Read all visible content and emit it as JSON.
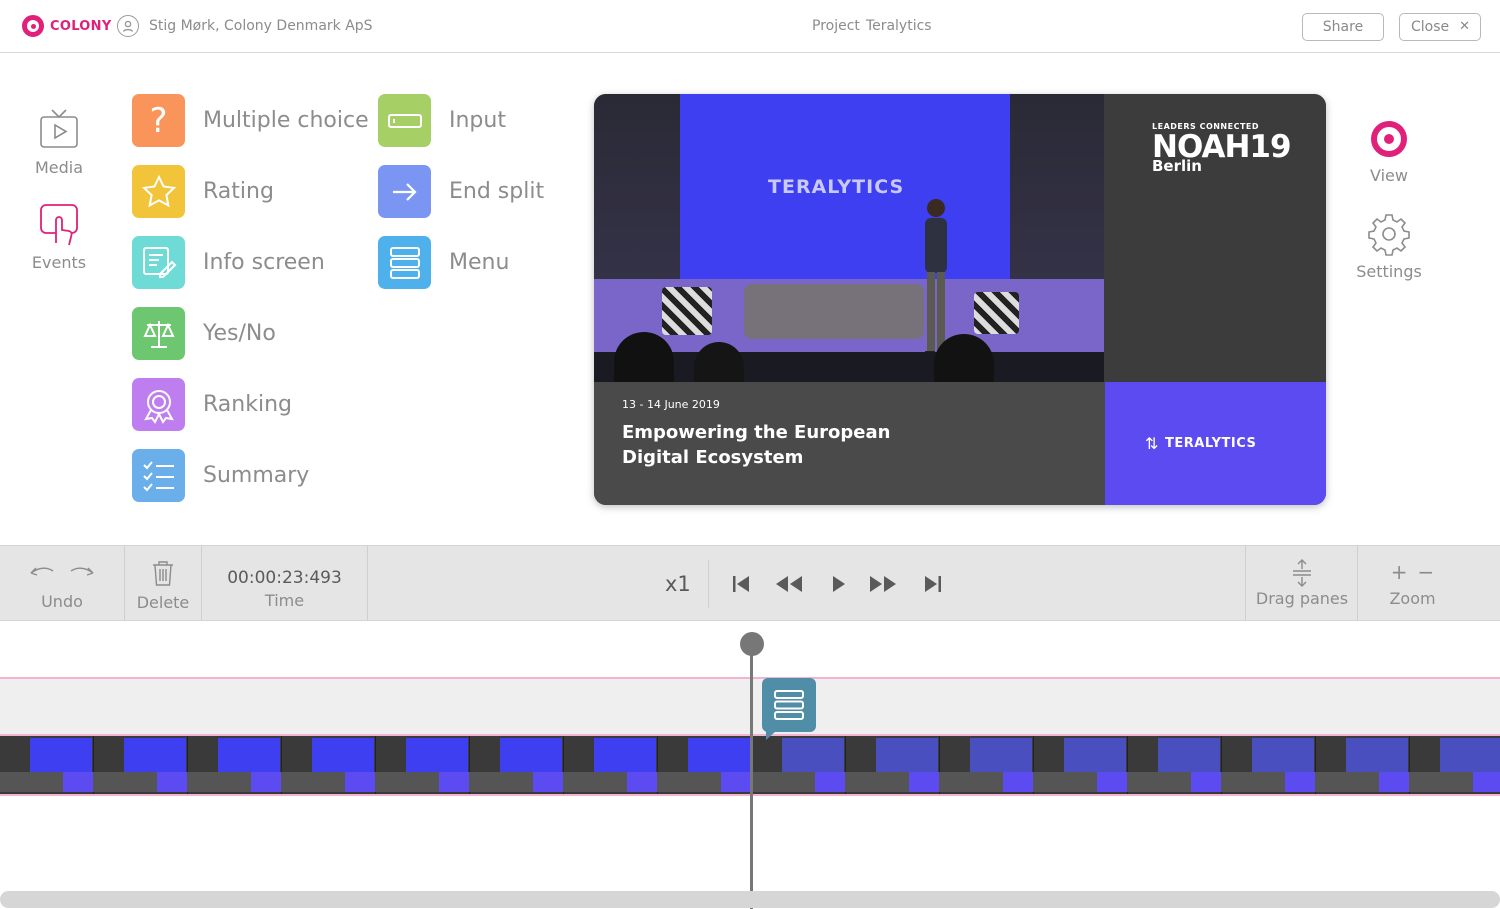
{
  "header": {
    "logo_text": "COLONY",
    "user": "Stig Mørk, Colony Denmark ApS",
    "project_label": "Project",
    "project_name": "Teralytics",
    "share_label": "Share",
    "close_label": "Close"
  },
  "sidebar": {
    "items": [
      {
        "label": "Media",
        "icon": "tv-play-icon"
      },
      {
        "label": "Events",
        "icon": "touch-icon"
      }
    ]
  },
  "question_types": {
    "col1": [
      {
        "label": "Multiple choice",
        "icon": "question-mark-icon",
        "color": "#f9945a"
      },
      {
        "label": "Rating",
        "icon": "star-icon",
        "color": "#f2c43a"
      },
      {
        "label": "Info screen",
        "icon": "info-edit-icon",
        "color": "#6fdbd6"
      },
      {
        "label": "Yes/No",
        "icon": "scales-icon",
        "color": "#6cc770"
      },
      {
        "label": "Ranking",
        "icon": "badge-icon",
        "color": "#bf7ef0"
      },
      {
        "label": "Summary",
        "icon": "checklist-icon",
        "color": "#6aafe9"
      }
    ],
    "col2": [
      {
        "label": "Input",
        "icon": "input-field-icon",
        "color": "#a6cf66"
      },
      {
        "label": "End split",
        "icon": "arrow-right-icon",
        "color": "#7b96f2"
      },
      {
        "label": "Menu",
        "icon": "menu-stack-icon",
        "color": "#4fb1ec"
      }
    ]
  },
  "preview": {
    "screen_brand": "TERALYTICS",
    "event_tagline": "LEADERS CONNECTED",
    "event_name": "NOAH19",
    "event_city": "Berlin",
    "date": "13 - 14 June 2019",
    "headline": "Empowering the European Digital Ecosystem",
    "sponsor": "TERALYTICS"
  },
  "right_panel": {
    "view_label": "View",
    "settings_label": "Settings"
  },
  "toolbar": {
    "undo_label": "Undo",
    "delete_label": "Delete",
    "time_value": "00:00:23:493",
    "time_label": "Time",
    "speed": "x1",
    "drag_label": "Drag panes",
    "zoom_label": "Zoom"
  },
  "colors": {
    "accent": "#e0207a",
    "event_marker": "#4f8ea6",
    "track_border": "#f2b4d2"
  }
}
